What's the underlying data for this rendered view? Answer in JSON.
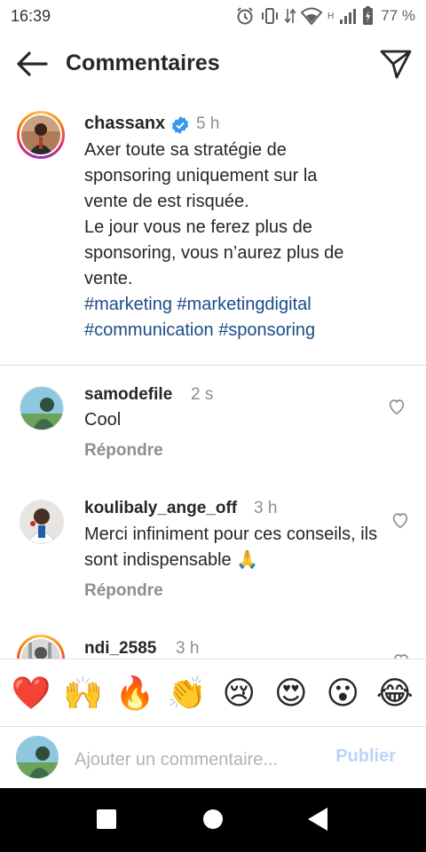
{
  "status_bar": {
    "time": "16:39",
    "network_label": "H",
    "battery_percent": "77 %",
    "icons": [
      "alarm-icon",
      "vibrate-icon",
      "data-arrows-icon",
      "wifi-icon",
      "signal-icon",
      "battery-icon"
    ]
  },
  "header": {
    "title": "Commentaires",
    "back_icon": "arrow-left-icon",
    "share_icon": "paper-plane-icon"
  },
  "caption": {
    "username": "chassanx",
    "verified": true,
    "time": "5 h",
    "text": "Axer toute sa stratégie de\nsponsoring uniquement sur la\nvente de est risquée.\nLe jour vous ne ferez plus de\nsponsoring, vous n’aurez plus de\nvente.",
    "hashtags": [
      "#marketing",
      "#marketingdigital",
      "#communication",
      "#sponsoring"
    ]
  },
  "comments": [
    {
      "username": "samodefile",
      "time": "2 s",
      "text": "Cool",
      "reply_label": "Répondre"
    },
    {
      "username": "koulibaly_ange_off",
      "time": "3 h",
      "text": "Merci infiniment pour ces conseils, ils sont indispensable 🙏",
      "reply_label": "Répondre"
    },
    {
      "username": "ndi_2585",
      "time": "3 h"
    }
  ],
  "emoji_bar": [
    "❤️",
    "🙌",
    "🔥",
    "👏",
    "😢",
    "😍",
    "😮",
    "😂"
  ],
  "comment_input": {
    "placeholder": "Ajouter un commentaire...",
    "publish_label": "Publier"
  },
  "colors": {
    "text": "#262626",
    "muted": "#8e8e8e",
    "hashtag": "#1b4c88",
    "publish_disabled": "#b8d6f5",
    "verified": "#3897f0"
  }
}
